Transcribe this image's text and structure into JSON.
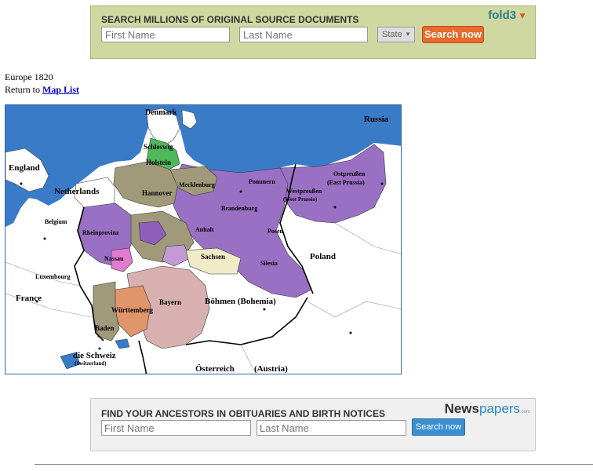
{
  "fold3": {
    "heading": "SEARCH MILLIONS OF ORIGINAL SOURCE DOCUMENTS",
    "logo": "fold3",
    "first_name_placeholder": "First Name",
    "last_name_placeholder": "Last Name",
    "state_label": "State",
    "search_label": "Search now"
  },
  "page": {
    "title": "Europe 1820",
    "return_prefix": "Return to",
    "return_link": "Map List"
  },
  "map": {
    "labels": {
      "denmark": "Denmark",
      "russia": "Russia",
      "schleswig": "Schleswig",
      "holstein": "Holstein",
      "england": "England",
      "mecklenburg": "Mecklenburg",
      "pommern": "Pommern",
      "ostpreussen": "Ostpreußen",
      "east_prussia": "(East Prussia)",
      "netherlands": "Netherlands",
      "hannover": "Hannover",
      "westpreussen": "Westpreußen",
      "west_prussia": "(West Prussia)",
      "brandenburg": "Brandenburg",
      "belgium": "Belgium",
      "rheinprovinz": "Rheinprovinz",
      "anhalt": "Anhalt",
      "posen": "Posen",
      "nassau": "Nassau",
      "sachsen": "Sachsen",
      "poland": "Poland",
      "silesia": "Silesia",
      "luxembourg": "Luxembourg",
      "france": "France",
      "bayern": "Bayern",
      "bohmen": "Böhmen (Bohemia)",
      "wurttemberg": "Württemberg",
      "baden": "Baden",
      "schweiz": "die Schweiz",
      "switzerland": "(Switzerland)",
      "osterreich": "Österreich",
      "austria": "(Austria)"
    }
  },
  "newspapers": {
    "heading": "FIND YOUR ANCESTORS IN OBITUARIES AND BIRTH NOTICES",
    "logo_main": "News",
    "logo_accent": "papers",
    "logo_suffix": ".com",
    "first_name_placeholder": "First Name",
    "last_name_placeholder": "Last Name",
    "search_label": "Search now"
  }
}
